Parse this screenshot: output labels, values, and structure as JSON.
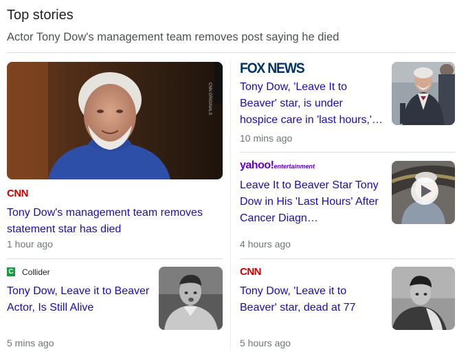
{
  "section": {
    "title": "Top stories",
    "query_headline": "Actor Tony Dow's management team removes post saying he died"
  },
  "stories": [
    {
      "source": "CNN",
      "headline": "Tony Dow's management team removes statement star has died",
      "time": "1 hour ago",
      "thumbnail_caption": "CNN ORIGINALS"
    },
    {
      "source": "FOX NEWS",
      "headline": "Tony Dow, 'Leave It to Beaver' star, is under hospice care in 'last hours,'…",
      "time": "10 mins ago"
    },
    {
      "source_main": "yahoo!",
      "source_sub": "entertainment",
      "headline": "Leave It to Beaver Star Tony Dow in His 'Last Hours' After Cancer Diagn…",
      "time": "4 hours ago"
    },
    {
      "source_badge": "C",
      "source": "Collider",
      "headline": "Tony Dow, Leave it to Beaver Actor, Is Still Alive",
      "time": "5 mins ago"
    },
    {
      "source": "CNN",
      "headline": "Tony Dow, 'Leave it to Beaver' star, dead at 77",
      "time": "5 hours ago"
    }
  ],
  "colors": {
    "link": "#1a0dab",
    "meta": "#70757a",
    "cnn": "#cc0000",
    "fox": "#003366",
    "yahoo": "#6001d2",
    "collider": "#1b9b3f"
  },
  "icons": [
    "play-icon"
  ]
}
